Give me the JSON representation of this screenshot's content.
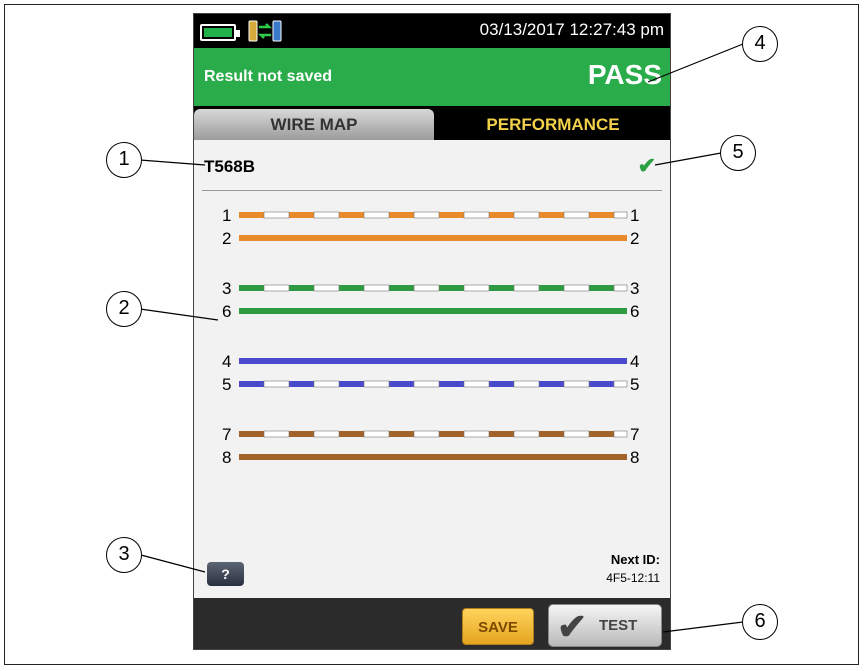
{
  "status_bar": {
    "datetime": "03/13/2017 12:27:43 pm",
    "battery_icon": "battery-icon",
    "connection_icon": "link-icon"
  },
  "result": {
    "status_text": "Result not saved",
    "verdict": "PASS",
    "color": "#2aac4a"
  },
  "tabs": [
    {
      "label": "WIRE MAP",
      "active": false
    },
    {
      "label": "PERFORMANCE",
      "active": true
    }
  ],
  "wire_map": {
    "standard": "T568B",
    "status_icon": "check-icon",
    "pairs": [
      {
        "wires": [
          {
            "left": "1",
            "right": "1",
            "color": "#e8892a",
            "striped": true
          },
          {
            "left": "2",
            "right": "2",
            "color": "#e8892a",
            "striped": false
          }
        ]
      },
      {
        "wires": [
          {
            "left": "3",
            "right": "3",
            "color": "#2e9a42",
            "striped": true
          },
          {
            "left": "6",
            "right": "6",
            "color": "#2e9a42",
            "striped": false
          }
        ]
      },
      {
        "wires": [
          {
            "left": "4",
            "right": "4",
            "color": "#4a4acc",
            "striped": false
          },
          {
            "left": "5",
            "right": "5",
            "color": "#4a4acc",
            "striped": true
          }
        ]
      },
      {
        "wires": [
          {
            "left": "7",
            "right": "7",
            "color": "#a2622a",
            "striped": true
          },
          {
            "left": "8",
            "right": "8",
            "color": "#a2622a",
            "striped": false
          }
        ]
      }
    ]
  },
  "help": {
    "label": "?"
  },
  "next_id": {
    "label": "Next ID:",
    "value": "4F5-12:11"
  },
  "buttons": {
    "save": "SAVE",
    "test": "TEST"
  },
  "callouts": [
    "1",
    "2",
    "3",
    "4",
    "5",
    "6"
  ]
}
